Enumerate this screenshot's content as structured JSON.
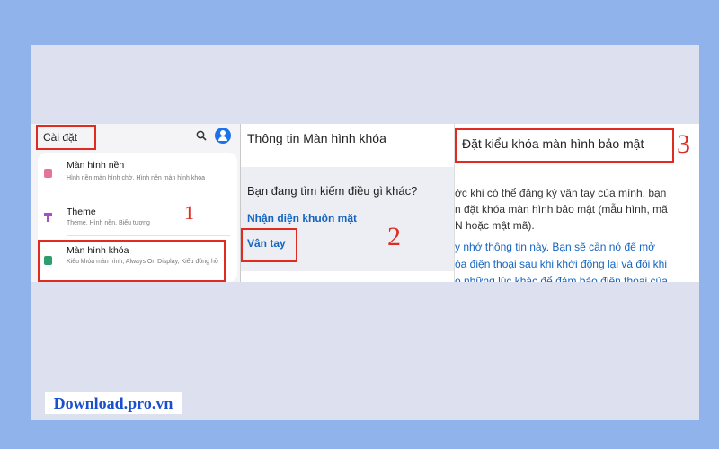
{
  "panel1": {
    "title": "Cài đặt",
    "items": [
      {
        "title": "Màn hình nền",
        "subtitle": "Hình nền màn hình chờ, Hình nền màn hình khóa",
        "icon": "wallpaper-icon",
        "color": "#e57399"
      },
      {
        "title": "Theme",
        "subtitle": "Theme, Hình nền, Biểu tượng",
        "icon": "theme-icon",
        "color": "#a44fc7"
      },
      {
        "title": "Màn hình khóa",
        "subtitle": "Kiểu khóa màn hình, Always On Display, Kiểu đồng hồ",
        "icon": "lock-icon",
        "color": "#2f9e6e"
      }
    ]
  },
  "panel2": {
    "header": "Thông tin Màn hình khóa",
    "question": "Bạn đang tìm kiếm điều gì khác?",
    "links": [
      "Nhận diện khuôn mặt",
      "Vân tay"
    ]
  },
  "panel3": {
    "header": "Đặt kiểu khóa màn hình bảo mật",
    "lines": [
      "ớc khi có thể đăng ký vân tay của mình, bạn",
      "n đặt khóa màn hình bảo mật (mẫu hình, mã",
      "N hoặc mật mã).",
      "y nhớ thông tin này. Bạn sẽ cần nó để mở",
      "óa điện thoại sau khi khởi động lại và đôi khi",
      "o những lúc khác để đảm bảo điện thoại của"
    ]
  },
  "annotations": {
    "step1": "1",
    "step2": "2",
    "step3": "3"
  },
  "watermark": "Download.pro.vn",
  "colors": {
    "background": "#8fb3ea",
    "annotation": "#e02b20",
    "link": "#1565c0"
  }
}
